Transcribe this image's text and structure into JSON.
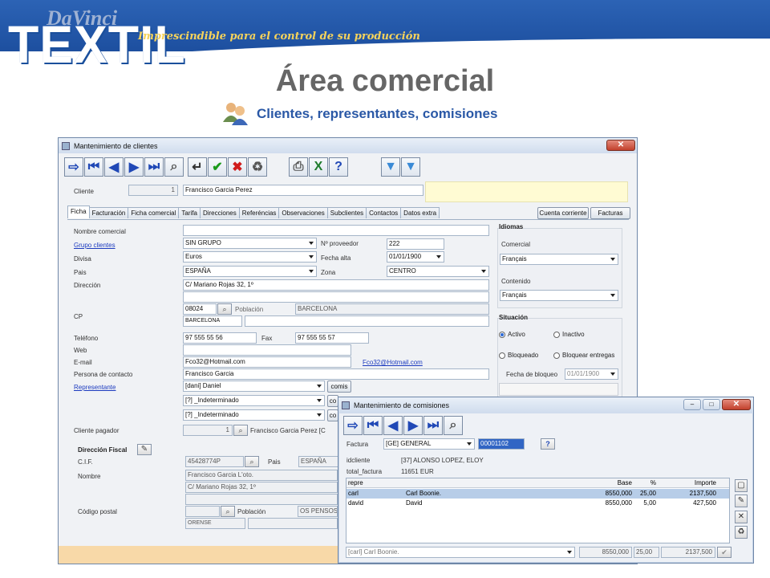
{
  "brand": {
    "top": "DaVinci",
    "main": "TEXTIL",
    "slogan": "Imprescindible para el control de su producción"
  },
  "page": {
    "title": "Área comercial",
    "subtitle": "Clientes, representantes, comisiones"
  },
  "clientes_window": {
    "title": "Mantenimiento de clientes",
    "client_label": "Cliente",
    "client_code": "1",
    "client_name": "Francisco Garcia  Perez",
    "tabs": [
      "Ficha",
      "Facturación",
      "Ficha comercial",
      "Tarifa",
      "Direcciones",
      "Referéncias",
      "Observaciones",
      "Subclientes",
      "Contactos",
      "Datos extra"
    ],
    "buttons": {
      "cuenta": "Cuenta corriente",
      "facturas": "Facturas"
    },
    "fields": {
      "nombre_comercial": "Nombre comercial",
      "grupo_clientes": "Grupo clientes",
      "grupo_value": "SIN GRUPO",
      "n_proveedor": "Nº proveedor",
      "n_proveedor_value": "222",
      "divisa": "Divisa",
      "divisa_value": "Euros",
      "fecha_alta": "Fecha alta",
      "fecha_alta_value": "01/01/1900",
      "pais": "Pais",
      "pais_value": "ESPAÑA",
      "zona": "Zona",
      "zona_value": "CENTRO",
      "direccion": "Dirección",
      "direccion_value": "C/ Mariano Rojas 32, 1º",
      "cp": "CP",
      "cp_value": "08024",
      "poblacion": "Población",
      "poblacion_value": "BARCELONA",
      "poblacion_sub": "BARCELONA",
      "telefono": "Teléfono",
      "telefono_value": "97 555 55 56",
      "fax": "Fax",
      "fax_value": "97 555 55 57",
      "web": "Web",
      "email": "E-mail",
      "email_value": "Fco32@Hotmail.com",
      "email_link": "Fco32@Hotmail.com",
      "contacto": "Persona de contacto",
      "contacto_value": "Francisco Garcia",
      "representante": "Representante",
      "rep1": "[dani] Daniel",
      "rep2": "[?] _Indeterminado",
      "rep3": "[?] _Indeterminado",
      "comis": "comis",
      "co": "co",
      "cliente_pagador": "Cliente pagador",
      "pagador_code": "1",
      "pagador_name": "Francisco Garcia  Perez [C",
      "dir_fiscal": "Dirección Fiscal",
      "cif": "C.I.F.",
      "cif_value": "45428774P",
      "pais2": "Pais",
      "pais2_value": "ESPAÑA",
      "nombre": "Nombre",
      "nombre_value": "Francisco Garcia L'oto.",
      "nombre_value2": "C/ Mariano Rojas 32, 1º",
      "codigo_postal": "Código postal",
      "poblacion2": "Población",
      "poblacion2_value": "OS PENSOS",
      "poblacion2_sub": "ORENSE"
    },
    "idiomas": {
      "title": "Idiomas",
      "comercial": "Comercial",
      "comercial_value": "Français",
      "contenido": "Contenido",
      "contenido_value": "Français"
    },
    "situacion": {
      "title": "Situación",
      "activo": "Activo",
      "inactivo": "Inactivo",
      "bloqueado": "Bloqueado",
      "bloquear": "Bloquear entregas",
      "fecha_bloqueo": "Fecha de bloqueo",
      "fecha_bloqueo_value": "01/01/1900"
    }
  },
  "comisiones_window": {
    "title": "Mantenimiento de comisiones",
    "factura": "Factura",
    "factura_value": "[GE] GENERAL",
    "factura_num": "00001102",
    "idcliente": "idcliente",
    "idcliente_value": "[37] ALONSO LOPEZ, ELOY",
    "total_factura": "total_factura",
    "total_value": "11651 EUR",
    "columns": [
      "repre",
      "Base",
      "%",
      "Importe"
    ],
    "rows": [
      {
        "repre": "carl",
        "name": "Carl Boonie.",
        "base": "8550,000",
        "pct": "25,00",
        "importe": "2137,500"
      },
      {
        "repre": "david",
        "name": "David",
        "base": "8550,000",
        "pct": "5,00",
        "importe": "427,500"
      }
    ],
    "footer": {
      "repre": "[carl] Carl Boonie.",
      "base": "8550,000",
      "pct": "25,00",
      "importe": "2137,500"
    }
  }
}
